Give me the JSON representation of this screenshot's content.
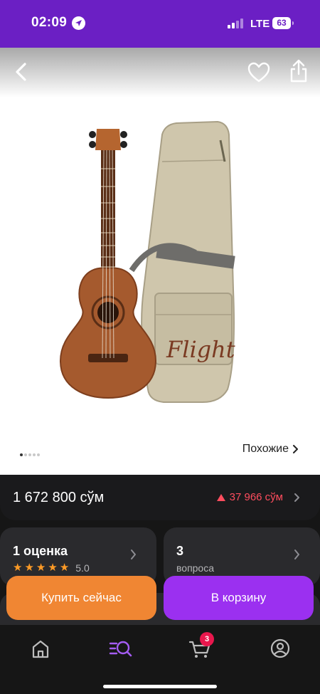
{
  "status_bar": {
    "time": "02:09",
    "network": "LTE",
    "battery": "63"
  },
  "gallery": {
    "slide_count": 5,
    "active_slide": 1,
    "similar_label": "Похожие",
    "brand_text": "Flight"
  },
  "price": {
    "amount": "1 672 800 сўм",
    "change": "37 966 сўм",
    "change_color": "#ff4d5e"
  },
  "rating_card": {
    "title": "1 оценка",
    "stars": 5,
    "value": "5.0"
  },
  "questions_card": {
    "title": "3",
    "subtitle": "вопроса"
  },
  "actions": {
    "buy_now": "Купить сейчас",
    "add_to_cart": "В корзину"
  },
  "nav": {
    "items": [
      "home-icon",
      "catalog-search-icon",
      "cart-icon",
      "profile-icon"
    ],
    "cart_badge": "3"
  },
  "colors": {
    "brand_purple": "#6B1FC4",
    "buy_orange": "#F08633",
    "cart_purple": "#9B30F0",
    "star_orange": "#ff9b26",
    "badge_red": "#e8174d"
  }
}
